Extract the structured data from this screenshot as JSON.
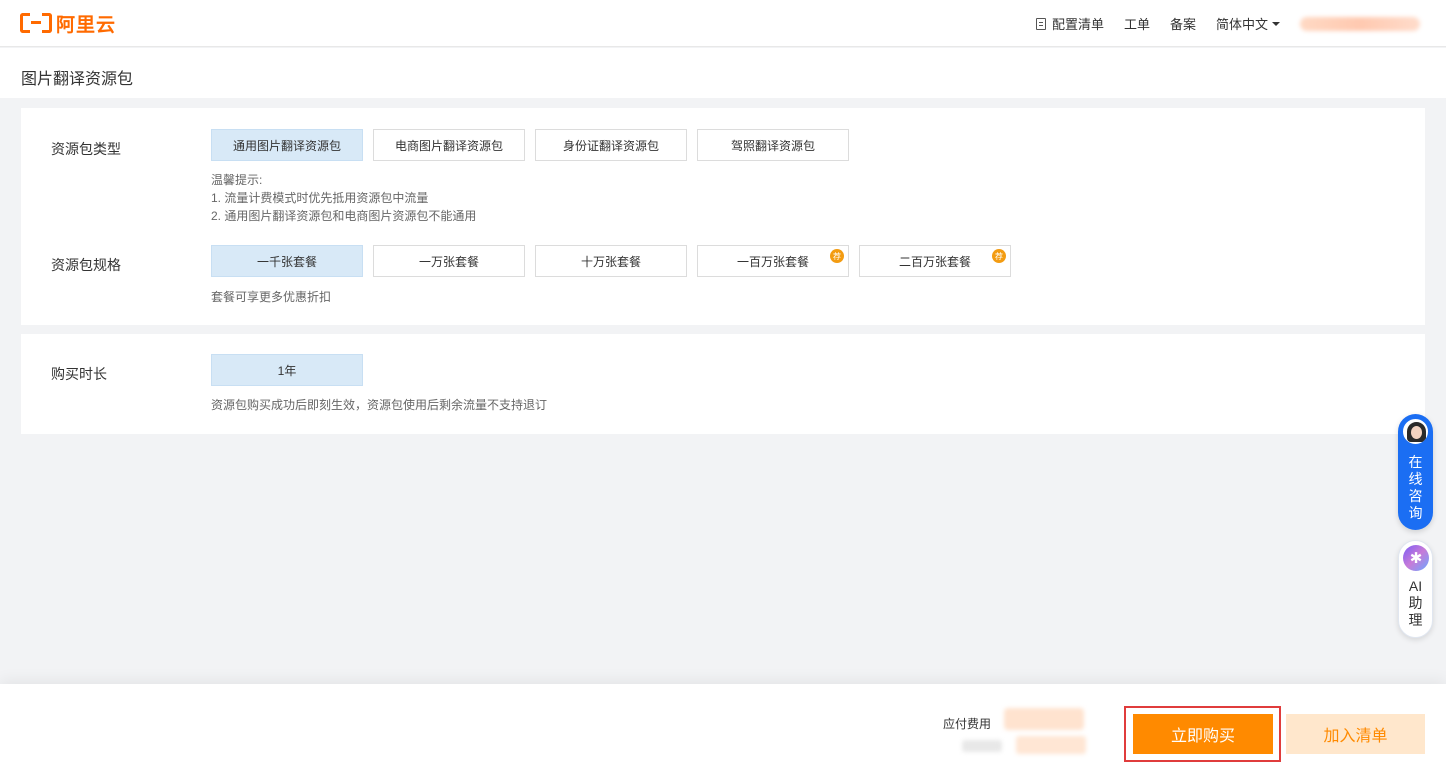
{
  "nav": {
    "logo_text": "阿里云",
    "items": [
      "配置清单",
      "工单",
      "备案"
    ],
    "language": "简体中文"
  },
  "page": {
    "title": "图片翻译资源包"
  },
  "package_type": {
    "label": "资源包类型",
    "options": [
      "通用图片翻译资源包",
      "电商图片翻译资源包",
      "身份证翻译资源包",
      "驾照翻译资源包"
    ],
    "selected": "通用图片翻译资源包",
    "hint_title": "温馨提示:",
    "hint_lines": [
      "1. 流量计费模式时优先抵用资源包中流量",
      "2. 通用图片翻译资源包和电商图片资源包不能通用"
    ]
  },
  "package_spec": {
    "label": "资源包规格",
    "options": [
      "一千张套餐",
      "一万张套餐",
      "十万张套餐",
      "一百万张套餐",
      "二百万张套餐"
    ],
    "selected": "一千张套餐",
    "recommend_badge": "荐",
    "hint": "套餐可享更多优惠折扣"
  },
  "duration": {
    "label": "购买时长",
    "options": [
      "1年"
    ],
    "selected": "1年",
    "hint": "资源包购买成功后即刻生效，资源包使用后剩余流量不支持退订"
  },
  "side": {
    "consult_label": "在线咨询",
    "ai_label": "AI助理",
    "ai_icon": "sparkle-icon"
  },
  "footer": {
    "fee_label": "应付费用",
    "buy_label": "立即购买",
    "cart_label": "加入清单"
  },
  "colors": {
    "brand": "#ff6a00",
    "buy_button": "#ff8a00",
    "selected_option": "#d8e9f7",
    "consult_blue": "#1b6ef3",
    "highlight_frame": "#e03c3c"
  }
}
